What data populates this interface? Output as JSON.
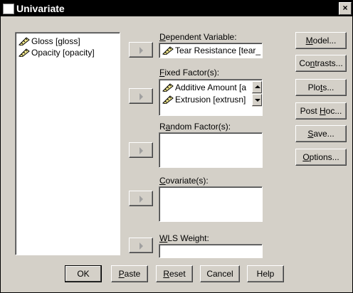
{
  "window": {
    "title": "Univariate",
    "close_glyph": "×"
  },
  "variables_list": [
    {
      "label": "Gloss [gloss]",
      "icon": "ruler-icon"
    },
    {
      "label": "Opacity [opacity]",
      "icon": "ruler-icon"
    }
  ],
  "dependent": {
    "label_pre": "",
    "label_u": "D",
    "label_post": "ependent Variable:",
    "value": "Tear Resistance [tear_"
  },
  "fixed": {
    "label_u": "F",
    "label_post": "ixed Factor(s):",
    "items": [
      "Additive Amount [a",
      "Extrusion [extrusn]"
    ]
  },
  "random": {
    "label_pre": "R",
    "label_u": "a",
    "label_post": "ndom Factor(s):"
  },
  "covariate": {
    "label_u": "C",
    "label_post": "ovariate(s):"
  },
  "wls": {
    "label_u": "W",
    "label_post": "LS Weight:"
  },
  "side_buttons": {
    "model": {
      "pre": "",
      "u": "M",
      "post": "odel..."
    },
    "contrasts": {
      "pre": "Co",
      "u": "n",
      "post": "trasts..."
    },
    "plots": {
      "pre": "Plo",
      "u": "t",
      "post": "s..."
    },
    "posthoc": {
      "pre": "Post ",
      "u": "H",
      "post": "oc..."
    },
    "save": {
      "pre": "",
      "u": "S",
      "post": "ave..."
    },
    "options": {
      "pre": "",
      "u": "O",
      "post": "ptions..."
    }
  },
  "bottom_buttons": {
    "ok": "OK",
    "paste": {
      "u": "P",
      "post": "aste"
    },
    "reset": {
      "u": "R",
      "post": "eset"
    },
    "cancel": "Cancel",
    "help": "Help"
  }
}
